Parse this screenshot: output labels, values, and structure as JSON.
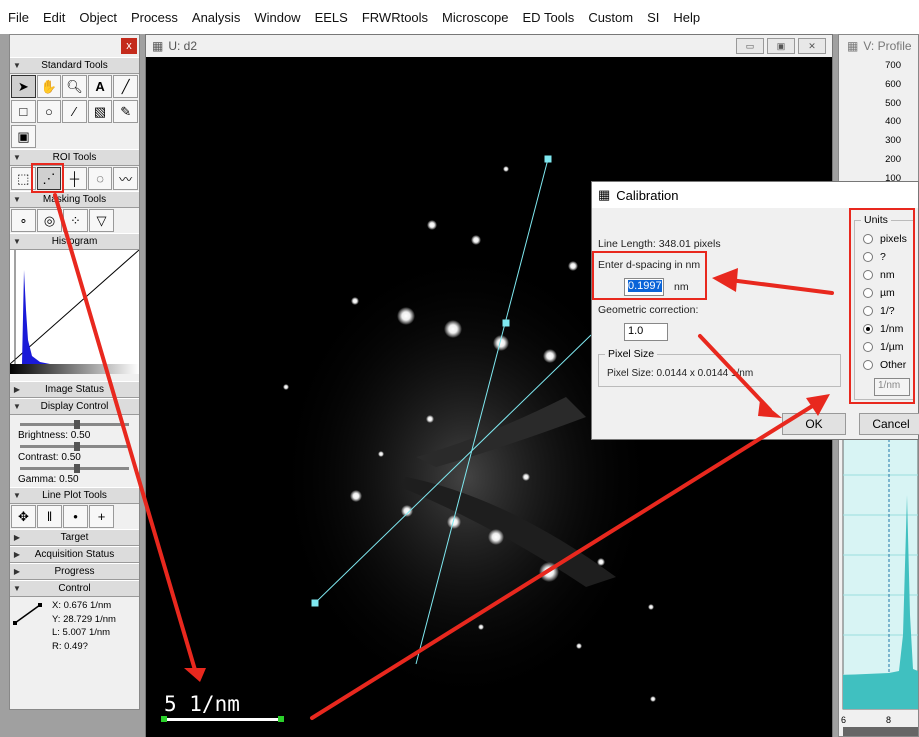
{
  "menu": [
    "File",
    "Edit",
    "Object",
    "Process",
    "Analysis",
    "Window",
    "EELS",
    "FRWRtools",
    "Microscope",
    "ED Tools",
    "Custom",
    "SI",
    "Help"
  ],
  "toolpanel": {
    "close": "x",
    "sections": {
      "standard": "Standard Tools",
      "roi": "ROI Tools",
      "masking": "Masking Tools",
      "histogram": "Histogram",
      "image_status": "Image Status",
      "display_control": "Display Control",
      "line_plot": "Line Plot Tools",
      "target": "Target",
      "acquisition": "Acquisition Status",
      "progress": "Progress",
      "control": "Control"
    },
    "brightness": "Brightness: 0.50",
    "contrast": "Contrast: 0.50",
    "gamma": "Gamma: 0.50",
    "readout": {
      "x": "X: 0.676 1/nm",
      "y": "Y: 28.729 1/nm",
      "l": "L: 5.007 1/nm",
      "r": "R: 0.49?"
    }
  },
  "image_window": {
    "title": "U: d2",
    "scalebar_label": "5 1/nm"
  },
  "profile_window": {
    "title": "V: Profile",
    "yticks": [
      "700",
      "600",
      "500",
      "400",
      "300",
      "200",
      "100"
    ],
    "xticks": [
      "6",
      "8"
    ]
  },
  "calibration_dialog": {
    "title": "Calibration",
    "line_length": "Line Length: 348.01 pixels",
    "dspacing_label": "Enter d-spacing in nm",
    "dspacing_value": "0.1997",
    "dspacing_unit": "nm",
    "geom_label": "Geometric correction:",
    "geom_value": "1.0",
    "pixel_size_group": "Pixel Size",
    "pixel_size_text": "Pixel Size: 0.0144 x 0.0144 1/nm",
    "units_group": "Units",
    "units": [
      "pixels",
      "?",
      "nm",
      "µm",
      "1/?",
      "1/nm",
      "1/µm",
      "Other"
    ],
    "selected_unit": "1/nm",
    "other_value": "1/nm",
    "ok": "OK",
    "cancel": "Cancel"
  },
  "colors": {
    "annotation": "#e8281e",
    "line_roi": "#7fe8f0",
    "profile": "#40c0c0"
  }
}
